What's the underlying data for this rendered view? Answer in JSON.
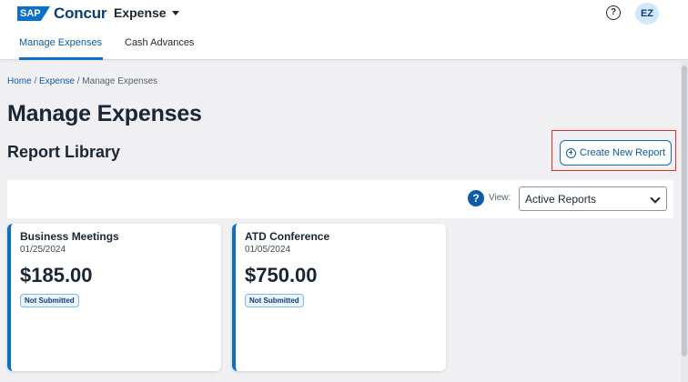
{
  "header": {
    "logo_badge": "SAP",
    "logo_word": "Concur",
    "app_menu_label": "Expense",
    "help_glyph": "?",
    "user_initials": "EZ",
    "tabs": [
      {
        "label": "Manage Expenses",
        "active": true
      },
      {
        "label": "Cash Advances",
        "active": false
      }
    ]
  },
  "breadcrumb": {
    "items": [
      "Home",
      "Expense",
      "Manage Expenses"
    ],
    "separator": " / "
  },
  "page_title": "Manage Expenses",
  "section_title": "Report Library",
  "create_button_label": "Create New Report",
  "filter": {
    "info_glyph": "?",
    "view_label": "View:",
    "view_selected": "Active Reports"
  },
  "reports": [
    {
      "name": "Business Meetings",
      "date": "01/25/2024",
      "amount": "$185.00",
      "status": "Not Submitted"
    },
    {
      "name": "ATD Conference",
      "date": "01/05/2024",
      "amount": "$750.00",
      "status": "Not Submitted"
    }
  ],
  "colors": {
    "brand_blue": "#0b6fcc",
    "highlight_red": "#d9342b",
    "page_background": "#f0f0f2"
  },
  "icons": {
    "help": "question-circle-icon",
    "info": "info-question-icon",
    "create": "plus-circle-icon",
    "app_menu": "caret-down-icon",
    "select": "chevron-down-icon"
  }
}
